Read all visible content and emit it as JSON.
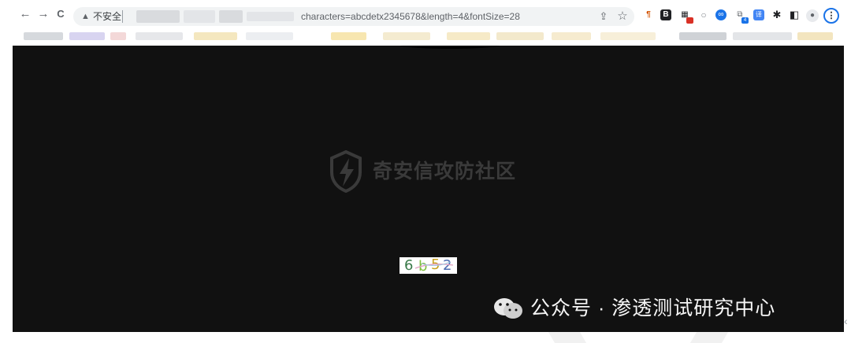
{
  "browser": {
    "back_icon": "arrow-left-icon",
    "back_glyph": "←",
    "forward_icon": "arrow-right-icon",
    "forward_glyph": "→",
    "reload_icon": "reload-icon",
    "reload_glyph": "C",
    "security_icon": "warning-triangle-icon",
    "security_glyph": "▲",
    "security_label": "不安全",
    "url_visible": "characters=abcdetx2345678&length=4&fontSize=28",
    "share_glyph": "⇪",
    "star_glyph": "☆",
    "extension_glyphs": [
      "¶",
      "B",
      "▦",
      "○",
      "∞",
      "⧉",
      "译",
      "✱",
      "◧"
    ],
    "extension_badge": "4",
    "profile_glyph": "●",
    "menu_glyph": "⋮",
    "accent_color": "#1a73e8"
  },
  "page": {
    "background": "#111111",
    "watermark_center": "奇安信攻防社区",
    "captcha_chars": [
      "6",
      "b",
      "5",
      "2"
    ],
    "captcha_colors": [
      "#3a7a4a",
      "#7fbf3f",
      "#c8a020",
      "#4a6ab0"
    ],
    "footer_watermark": "公众号 · 渗透测试研究中心",
    "scroll_glyph": "‹"
  }
}
